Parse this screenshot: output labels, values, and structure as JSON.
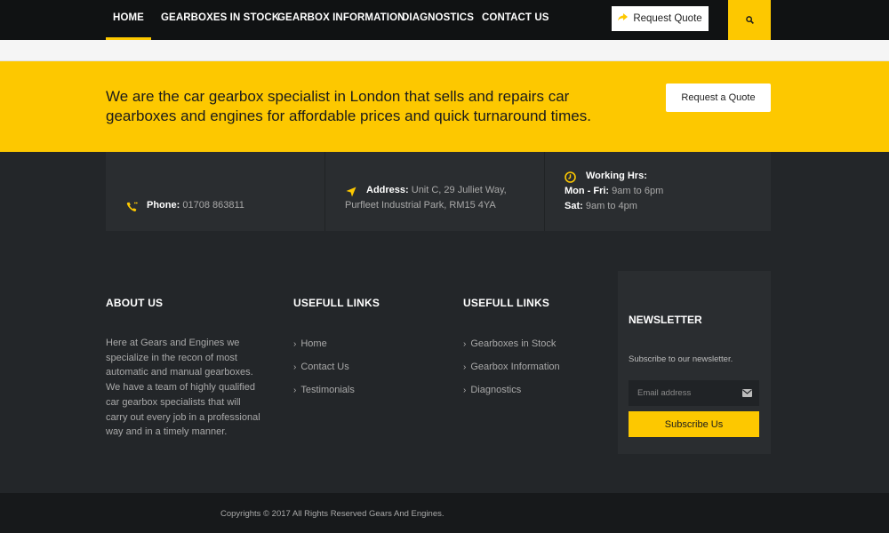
{
  "nav": {
    "items": [
      {
        "label": "HOME",
        "active": true
      },
      {
        "label": "GEARBOXES IN STOCK",
        "active": false
      },
      {
        "label": "GEARBOX INFORMATION",
        "active": false
      },
      {
        "label": "DIAGNOSTICS",
        "active": false
      },
      {
        "label": "CONTACT US",
        "active": false
      }
    ],
    "quote_label": "Request Quote",
    "quote_icon": "share-arrow-icon",
    "search_icon": "search-icon"
  },
  "banner": {
    "text": "We are the car gearbox specialist in London that sells and repairs car gearboxes and engines for affordable prices and quick turnaround times.",
    "button_label": "Request a Quote"
  },
  "contact": {
    "phone_label": "Phone:",
    "phone_value": "01708 863811",
    "address_label": "Address:",
    "address_line1": "Unit C, 29 Julliet Way,",
    "address_line2": "Purfleet Industrial Park, RM15 4YA",
    "hours_title": "Working Hrs:",
    "weekday_label": "Mon - Fri:",
    "weekday_value": "9am to 6pm",
    "saturday_label": "Sat:",
    "saturday_value": "9am to 4pm"
  },
  "footer": {
    "about_title": "ABOUT US",
    "about_text": "Here at Gears and Engines we specialize in the recon of most automatic and manual gearboxes. We have a team of highly qualified car gearbox specialists that will carry out every job in a professional way and in a timely manner.",
    "links1_title": "USEFULL LINKS",
    "links1": [
      "Home",
      "Contact Us",
      "Testimonials"
    ],
    "links2_title": "USEFULL LINKS",
    "links2": [
      "Gearboxes in Stock",
      "Gearbox Information",
      "Diagnostics"
    ],
    "newsletter_title": "NEWSLETTER",
    "newsletter_sub": "Subscribe to our newsletter.",
    "email_placeholder": "Email address",
    "subscribe_label": "Subscribe Us"
  },
  "copyright": "Copyrights © 2017 All Rights Reserved Gears And Engines.",
  "colors": {
    "accent": "#fdc800",
    "nav_bg": "#101213",
    "footer_bg": "#232629"
  }
}
